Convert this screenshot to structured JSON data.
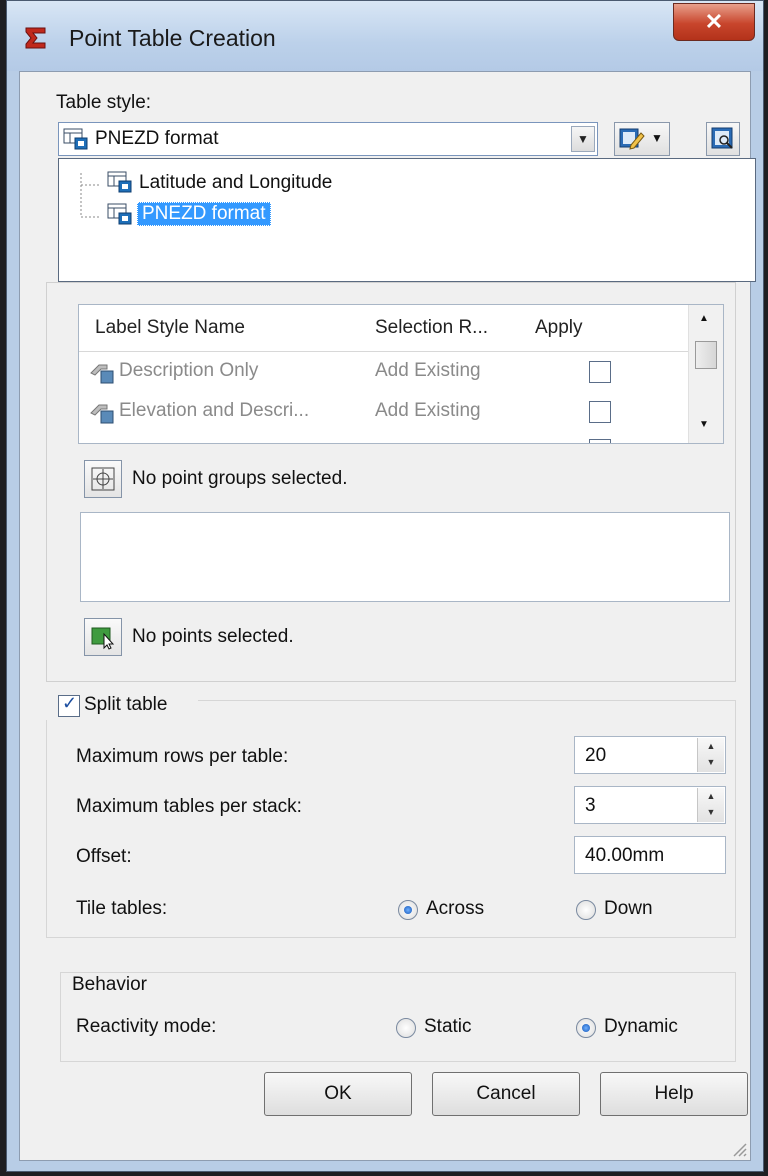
{
  "window": {
    "title": "Point Table Creation",
    "close_glyph": "✕"
  },
  "table_style": {
    "label": "Table style:",
    "selected": "PNEZD format",
    "options": [
      "Latitude and Longitude",
      "PNEZD format"
    ],
    "highlighted_index": 1
  },
  "selection": {
    "columns": [
      "Label Style Name",
      "Selection R...",
      "Apply"
    ],
    "rows": [
      {
        "name": "Description Only",
        "rule": "Add Existing",
        "apply": false
      },
      {
        "name": "Elevation and Descri...",
        "rule": "Add Existing",
        "apply": false
      }
    ],
    "point_groups_text": "No point groups selected.",
    "points_text": "No points selected."
  },
  "split_table": {
    "label": "Split table",
    "checked": true,
    "max_rows_label": "Maximum rows per table:",
    "max_rows_value": "20",
    "max_tables_label": "Maximum tables per stack:",
    "max_tables_value": "3",
    "offset_label": "Offset:",
    "offset_value": "40.00mm",
    "tile_label": "Tile tables:",
    "tile_options": [
      "Across",
      "Down"
    ],
    "tile_selected": "Across"
  },
  "behavior": {
    "label": "Behavior",
    "reactivity_label": "Reactivity mode:",
    "options": [
      "Static",
      "Dynamic"
    ],
    "selected": "Dynamic"
  },
  "buttons": {
    "ok": "OK",
    "cancel": "Cancel",
    "help": "Help"
  },
  "colors": {
    "selection_highlight": "#3399ff",
    "close_button": "#c8452c",
    "title_bar": "#bcd1ea"
  }
}
